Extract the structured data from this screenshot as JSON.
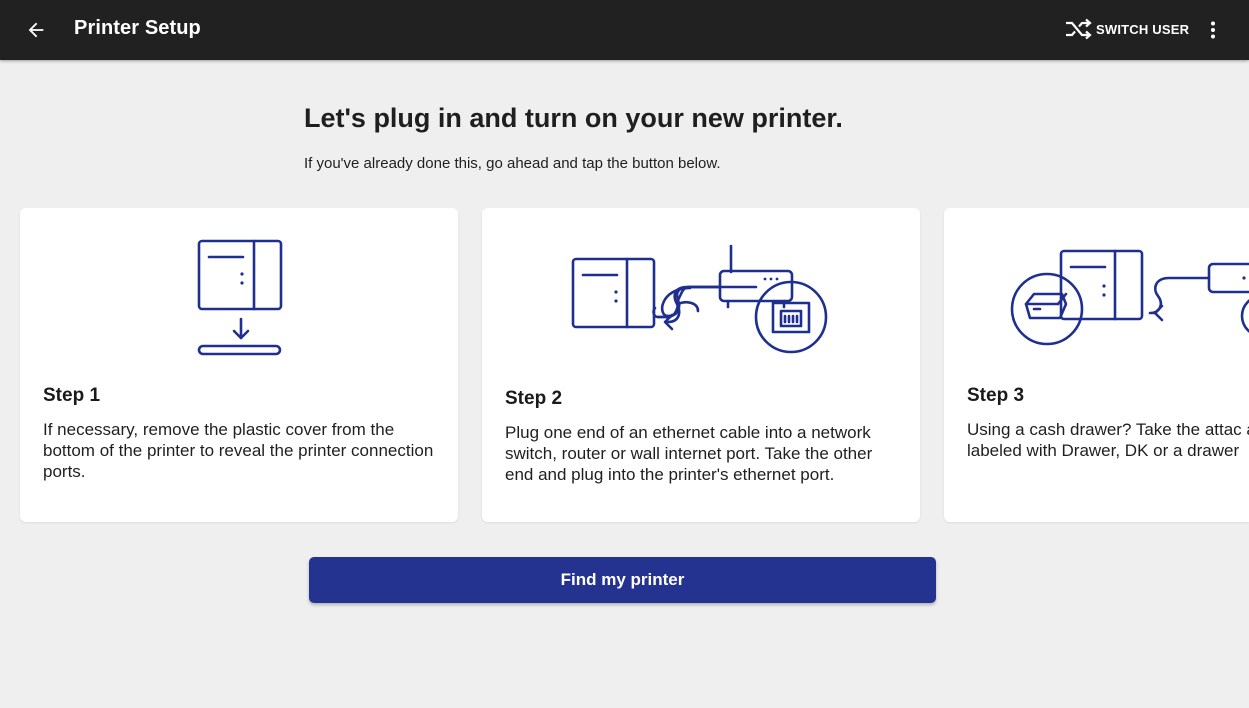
{
  "appbar": {
    "title": "Printer Setup",
    "switch_user_label": "SWITCH USER",
    "back_icon": "arrow-left-icon",
    "switch_icon": "shuffle-icon",
    "more_icon": "more-vert-icon"
  },
  "main": {
    "headline": "Let's plug in and turn on your new printer.",
    "subtext": "If you've already done this, go ahead and tap the button below."
  },
  "steps": [
    {
      "title": "Step 1",
      "text": "If necessary, remove the plastic cover from the bottom of the printer to reveal the printer connection ports."
    },
    {
      "title": "Step 2",
      "text": "Plug one end of an ethernet cable into a network switch, router or wall internet port. Take the other end and plug into the printer's ethernet port."
    },
    {
      "title": "Step 3",
      "text": "Using a cash drawer? Take the attac and plug into the printer's phone jac labeled with Drawer, DK or a drawer"
    }
  ],
  "find_button_label": "Find my printer",
  "colors": {
    "appbar_bg": "#212121",
    "background": "#efefef",
    "illustration": "#1f2f8f",
    "primary_button": "#243390"
  }
}
